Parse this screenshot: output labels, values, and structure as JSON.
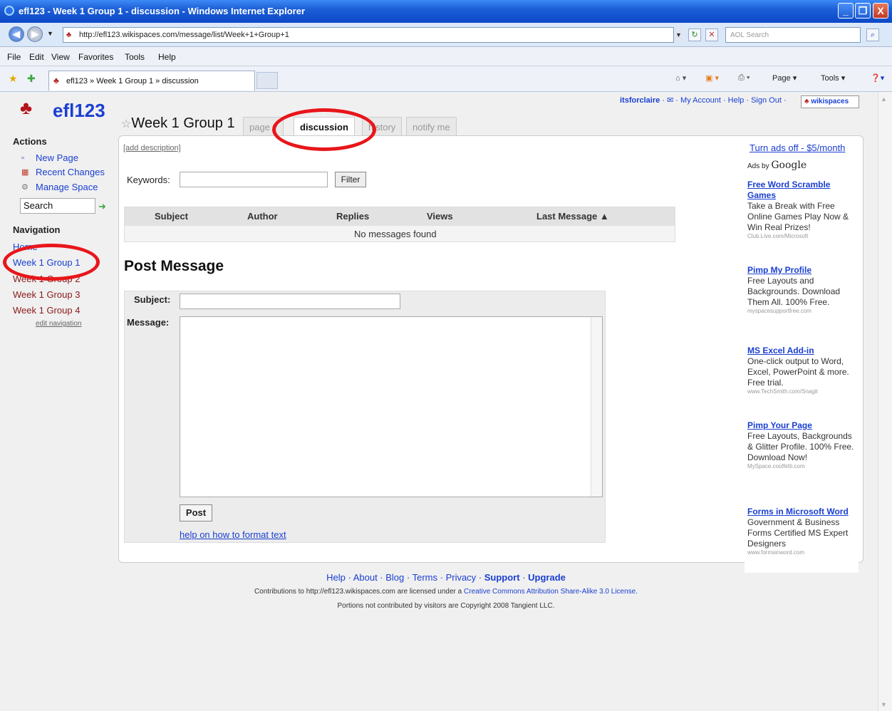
{
  "window": {
    "title": "efl123 - Week 1 Group 1 - discussion - Windows Internet Explorer",
    "min": "_",
    "max": "❐",
    "close": "X"
  },
  "address": {
    "url": "http://efl123.wikispaces.com/message/list/Week+1+Group+1",
    "search_placeholder": "AOL Search"
  },
  "menu": [
    "File",
    "Edit",
    "View",
    "Favorites",
    "Tools",
    "Help"
  ],
  "tab": {
    "title": "efl123 » Week 1 Group 1 » discussion"
  },
  "commands": {
    "page": "Page ▾",
    "tools": "Tools ▾"
  },
  "site": {
    "name": "efl123"
  },
  "sidebar": {
    "actions_heading": "Actions",
    "actions": [
      "New Page",
      "Recent Changes",
      "Manage Space"
    ],
    "search_value": "Search",
    "navigation_heading": "Navigation",
    "nav": [
      "Home",
      "Week 1 Group 1",
      "Week 1 Group 2",
      "Week 1 Group 3",
      "Week 1 Group 4"
    ],
    "edit_navigation": "edit navigation"
  },
  "user": {
    "name": "itsforclaire",
    "my_account": "My Account",
    "help": "Help",
    "sign_out": "Sign Out",
    "badge": "wikispaces"
  },
  "page": {
    "title": "Week 1 Group 1",
    "tabs": [
      "page ▾",
      "discussion",
      "history",
      "notify me"
    ],
    "add_description": "[add description]",
    "keywords_label": "Keywords:",
    "filter_label": "Filter",
    "table": {
      "columns": [
        "Subject",
        "Author",
        "Replies",
        "Views",
        "Last Message ▲"
      ],
      "empty": "No messages found"
    },
    "post_heading": "Post Message",
    "subject_label": "Subject:",
    "message_label": "Message:",
    "post_button": "Post",
    "help_link": "help on how to format text"
  },
  "ads": {
    "turn_off": "Turn ads off - $5/month",
    "ads_by": "Ads by",
    "google": "Google",
    "items": [
      {
        "title": "Free Word Scramble Games",
        "body": "Take a Break with Free Online Games Play Now & Win Real Prizes!",
        "url": "Club.Live.com/Microsoft"
      },
      {
        "title": "Pimp My Profile",
        "body": "Free Layouts and Backgrounds. Download Them All. 100% Free.",
        "url": "myspacesupportfree.com"
      },
      {
        "title": "MS Excel Add-in",
        "body": "One-click output to Word, Excel, PowerPoint & more. Free trial.",
        "url": "www.TechSmith.com/Snagit"
      },
      {
        "title": "Pimp Your Page",
        "body": "Free Layouts, Backgrounds & Glitter Profile. 100% Free. Download Now!",
        "url": "MySpace.coolfetti.com"
      },
      {
        "title": "Forms in Microsoft Word",
        "body": "Government & Business Forms Certified MS Expert Designers",
        "url": "www.formsinword.com"
      }
    ]
  },
  "footer": {
    "links": [
      "Help",
      "About",
      "Blog",
      "Terms",
      "Privacy",
      "Support",
      "Upgrade"
    ],
    "license_prefix": "Contributions to http://efl123.wikispaces.com are licensed under a",
    "license_link": "Creative Commons Attribution Share-Alike 3.0 License.",
    "copyright": "Portions not contributed by visitors are Copyright 2008 Tangient LLC."
  },
  "colors": {
    "annotation": "#e8161a",
    "link": "#1a3fd1",
    "nav": "#8b1a1a"
  }
}
